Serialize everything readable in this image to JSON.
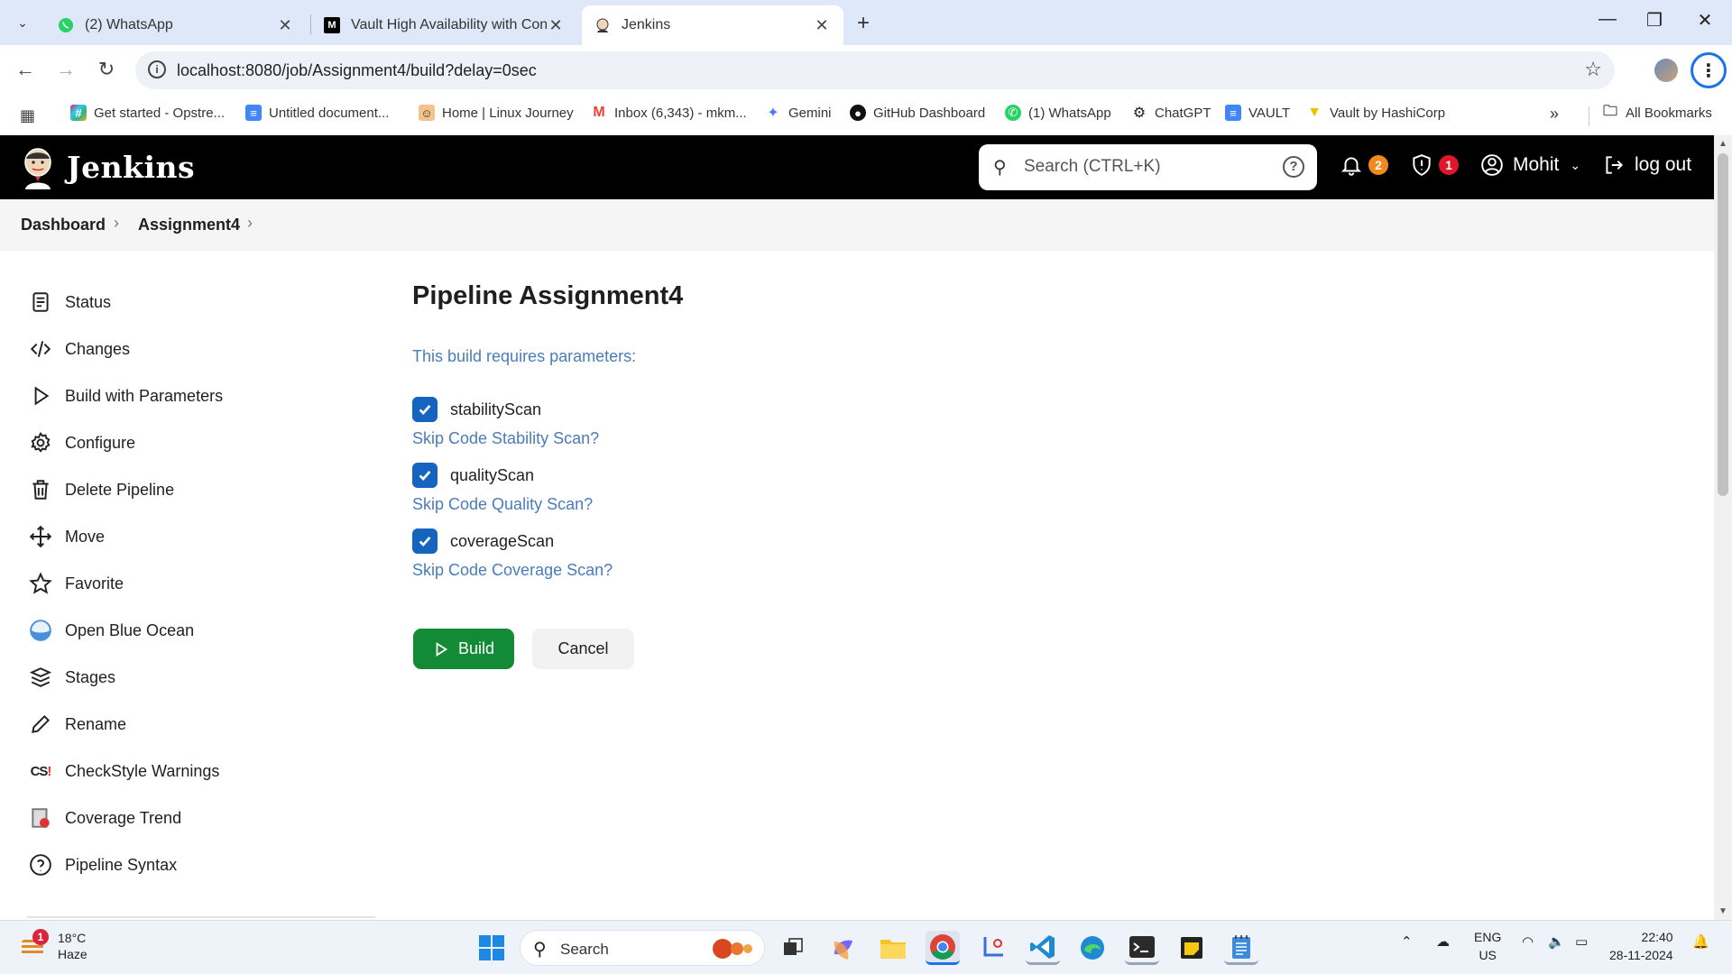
{
  "browser": {
    "tabs": [
      {
        "title": "(2) WhatsApp",
        "icon": "whatsapp-icon"
      },
      {
        "title": "Vault High Availability with Con",
        "icon": "medium-icon"
      },
      {
        "title": "Jenkins",
        "icon": "jenkins-icon",
        "active": true
      }
    ],
    "url": "localhost:8080/job/Assignment4/build?delay=0sec",
    "bookmarks": [
      {
        "label": "Get started - Opstre...",
        "icon": "slack-icon"
      },
      {
        "label": "Untitled document...",
        "icon": "docs-icon"
      },
      {
        "label": "Home | Linux Journey",
        "icon": "linux-journey-icon"
      },
      {
        "label": "Inbox (6,343) - mkm...",
        "icon": "gmail-icon"
      },
      {
        "label": "Gemini",
        "icon": "gemini-icon"
      },
      {
        "label": "GitHub Dashboard",
        "icon": "github-icon"
      },
      {
        "label": "(1) WhatsApp",
        "icon": "whatsapp-icon"
      },
      {
        "label": "ChatGPT",
        "icon": "chatgpt-icon"
      },
      {
        "label": "VAULT",
        "icon": "docs-icon"
      },
      {
        "label": "Vault by HashiCorp",
        "icon": "vault-icon"
      }
    ],
    "all_bookmarks": "All Bookmarks"
  },
  "header": {
    "brand": "Jenkins",
    "search_placeholder": "Search (CTRL+K)",
    "notifications_count": "2",
    "security_count": "1",
    "user": "Mohit",
    "logout": "log out"
  },
  "breadcrumb": [
    "Dashboard",
    "Assignment4"
  ],
  "sidebar": {
    "items": [
      {
        "label": "Status",
        "icon": "status-icon"
      },
      {
        "label": "Changes",
        "icon": "code-icon"
      },
      {
        "label": "Build with Parameters",
        "icon": "play-icon"
      },
      {
        "label": "Configure",
        "icon": "gear-icon"
      },
      {
        "label": "Delete Pipeline",
        "icon": "trash-icon"
      },
      {
        "label": "Move",
        "icon": "move-icon"
      },
      {
        "label": "Favorite",
        "icon": "star-icon"
      },
      {
        "label": "Open Blue Ocean",
        "icon": "blue-ocean-icon"
      },
      {
        "label": "Stages",
        "icon": "stages-icon"
      },
      {
        "label": "Rename",
        "icon": "pencil-icon"
      },
      {
        "label": "CheckStyle Warnings",
        "icon": "checkstyle-icon"
      },
      {
        "label": "Coverage Trend",
        "icon": "coverage-icon"
      },
      {
        "label": "Pipeline Syntax",
        "icon": "help-icon"
      }
    ]
  },
  "main": {
    "title": "Pipeline Assignment4",
    "requires_text": "This build requires parameters:",
    "parameters": [
      {
        "name": "stabilityScan",
        "checked": true,
        "description": "Skip Code Stability Scan?"
      },
      {
        "name": "qualityScan",
        "checked": true,
        "description": "Skip Code Quality Scan?"
      },
      {
        "name": "coverageScan",
        "checked": true,
        "description": "Skip Code Coverage Scan?"
      }
    ],
    "build_label": "Build",
    "cancel_label": "Cancel"
  },
  "taskbar": {
    "temperature": "18°C",
    "weather": "Haze",
    "weather_alert": "1",
    "search_label": "Search",
    "lang_top": "ENG",
    "lang_bottom": "US",
    "time": "22:40",
    "date": "28-11-2024"
  },
  "colors": {
    "jenkins_header": "#000000",
    "build_button": "#138a36",
    "checkbox": "#1565c0",
    "link_text": "#4a7db8",
    "notif_badge": "#f08a1c",
    "security_badge": "#e0162b"
  }
}
